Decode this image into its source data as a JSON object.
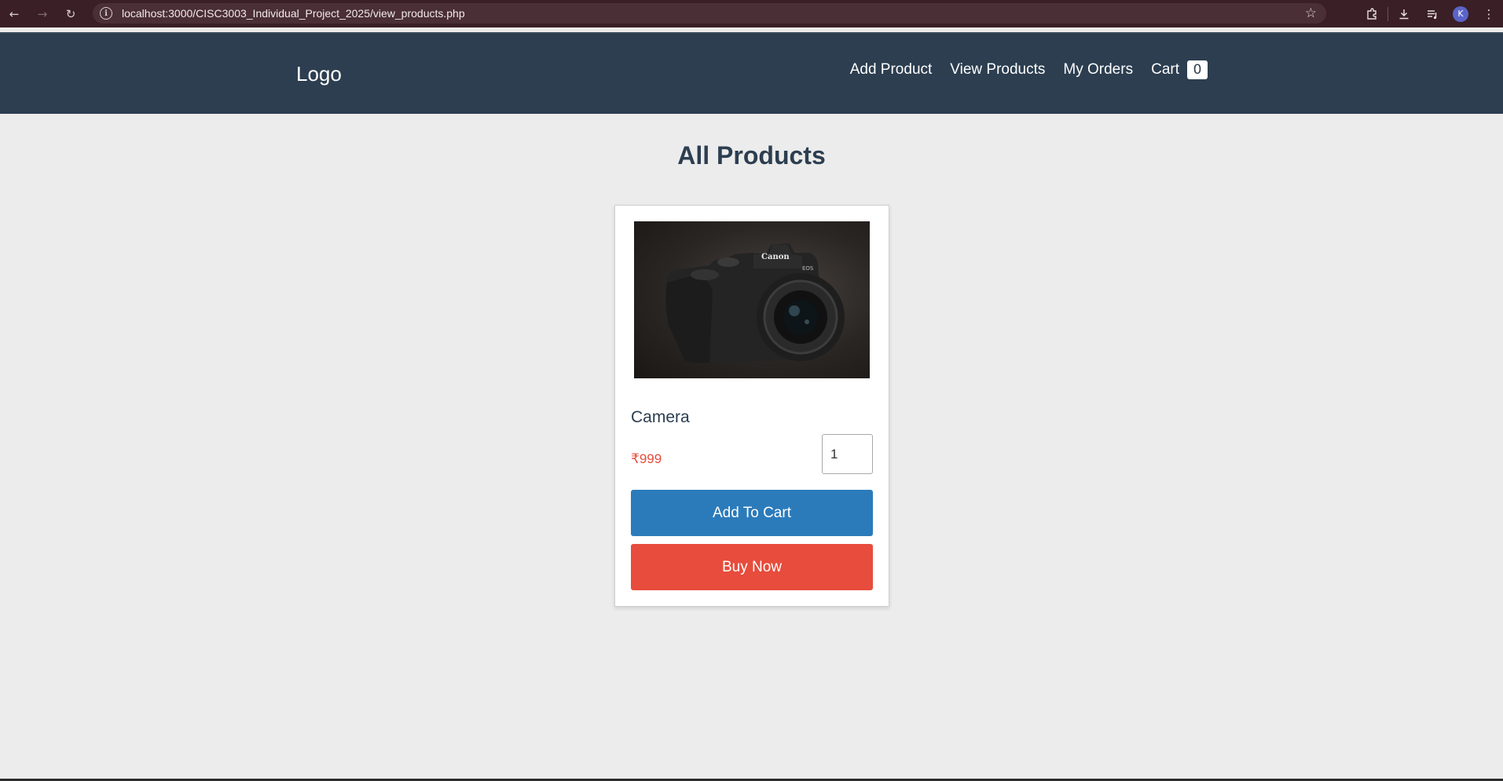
{
  "browser": {
    "url": "localhost:3000/CISC3003_Individual_Project_2025/view_products.php",
    "profile_initial": "K"
  },
  "header": {
    "logo": "Logo",
    "nav": {
      "add_product": "Add Product",
      "view_products": "View Products",
      "my_orders": "My Orders",
      "cart": "Cart",
      "cart_count": "0"
    }
  },
  "main": {
    "title": "All Products",
    "products": [
      {
        "name": "Camera",
        "price": "₹999",
        "quantity": "1",
        "add_to_cart_label": "Add To Cart",
        "buy_now_label": "Buy Now",
        "image_brand_text": "Canon",
        "image_model_text": "EOS"
      }
    ]
  },
  "colors": {
    "header_bg": "#2c3e50",
    "page_bg": "#ececec",
    "add_to_cart": "#2b7bbb",
    "buy_now": "#e74c3c",
    "price": "#e74c3c"
  }
}
